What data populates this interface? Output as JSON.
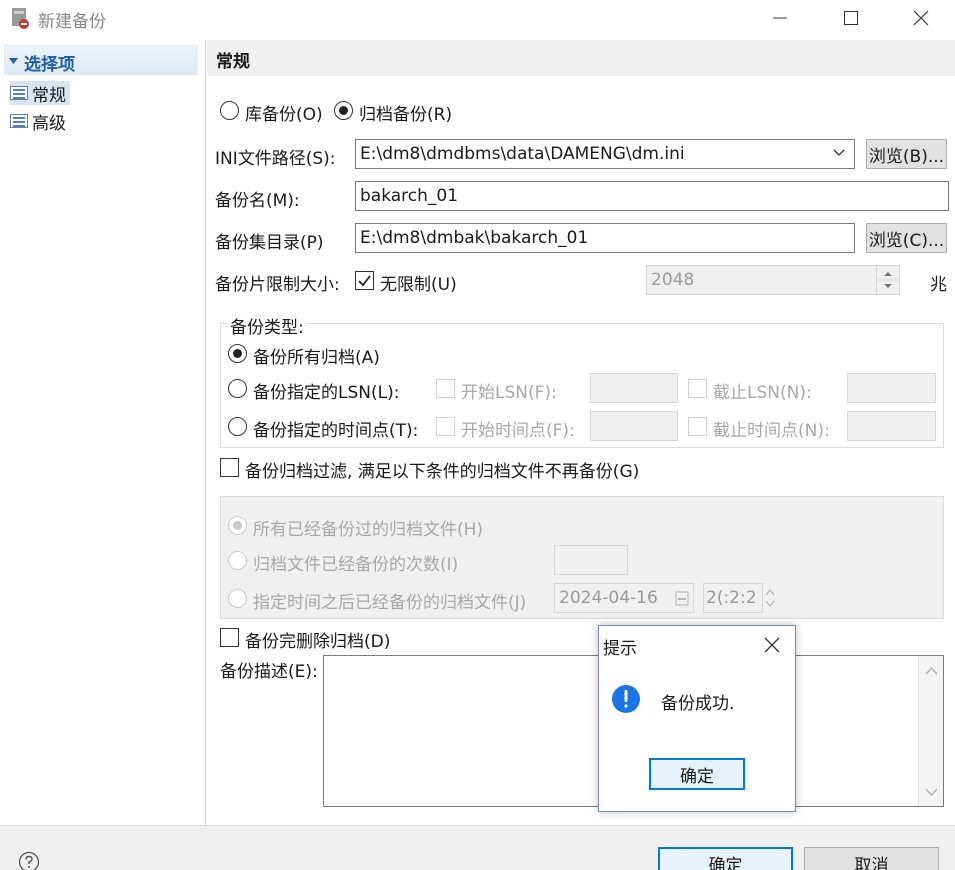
{
  "window": {
    "title": "新建备份",
    "icon": "backup-db-icon",
    "controls": [
      "minimize-icon",
      "maximize-icon",
      "close-icon"
    ]
  },
  "sidebar": {
    "header": "选择项",
    "items": [
      {
        "label": "常规",
        "selected": true
      },
      {
        "label": "高级",
        "selected": false
      }
    ]
  },
  "section": {
    "title": "常规"
  },
  "backup_mode": {
    "options": [
      {
        "label": "库备份(O)",
        "selected": false
      },
      {
        "label": "归档备份(R)",
        "selected": true
      }
    ]
  },
  "ini_path": {
    "label": "INI文件路径(S):",
    "value": "E:\\dm8\\dmdbms\\data\\DAMENG\\dm.ini",
    "browse": "浏览(B)..."
  },
  "backup_name": {
    "label": "备份名(M):",
    "value": "bakarch_01"
  },
  "backup_dir": {
    "label": "备份集目录(P)",
    "value": "E:\\dm8\\dmbak\\bakarch_01",
    "browse": "浏览(C)..."
  },
  "piece_limit": {
    "label": "备份片限制大小:",
    "unlimited_label": "无限制(U)",
    "unlimited": true,
    "size": "2048",
    "unit": "兆"
  },
  "backup_type": {
    "legend": "备份类型:",
    "all": "备份所有归档(A)",
    "lsn": "备份指定的LSN(L):",
    "lsn_start": "开始LSN(F):",
    "lsn_end": "截止LSN(N):",
    "time": "备份指定的时间点(T):",
    "time_start": "开始时间点(F):",
    "time_end": "截止时间点(N):"
  },
  "filter": {
    "label": "备份归档过滤, 满足以下条件的归档文件不再备份(G)",
    "opt_all": "所有已经备份过的归档文件(H)",
    "opt_count": "归档文件已经备份的次数(I)",
    "opt_after": "指定时间之后已经备份的归档文件(J)",
    "date": "2024-04-16",
    "time": "2(:2:2"
  },
  "delete_after": {
    "label": "备份完删除归档(D)"
  },
  "description": {
    "label": "备份描述(E):",
    "value": ""
  },
  "dialog": {
    "title": "提示",
    "message": "备份成功.",
    "ok": "确定",
    "icon": "info-exclamation-icon"
  },
  "footer": {
    "help_icon": "help-icon",
    "ok": "确定",
    "cancel": "取消"
  },
  "colors": {
    "accent": "#0078d7",
    "sidebar_header": "#1b5fa8",
    "info": "#1a73e8"
  }
}
